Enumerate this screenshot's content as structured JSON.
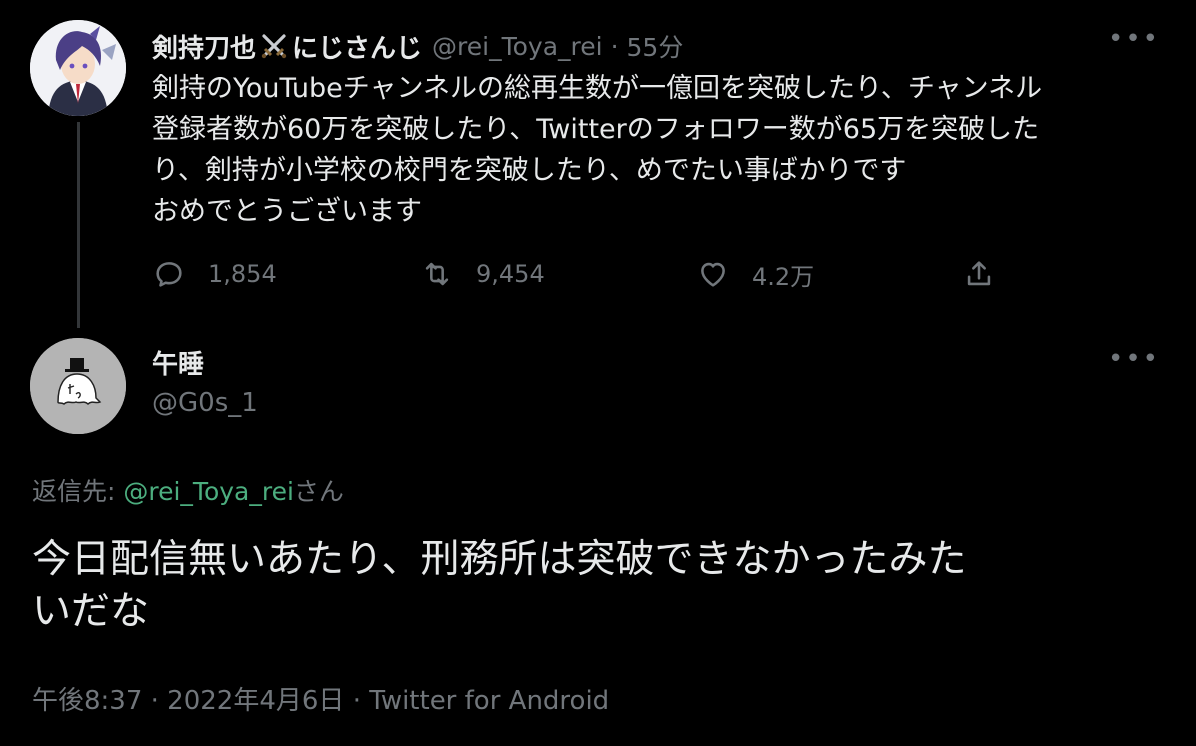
{
  "parent_tweet": {
    "display_name": "剣持刀也",
    "display_name_suffix": "にじさんじ",
    "handle": "@rei_Toya_rei",
    "separator": "·",
    "time": "55分",
    "more_label": "•••",
    "text_lines": [
      "剣持のYouTubeチャンネルの総再生数が一億回を突破したり、チャンネル",
      "登録者数が60万を突破したり、Twitterのフォロワー数が65万を突破した",
      "り、剣持が小学校の校門を突破したり、めでたい事ばかりです",
      "おめでとうございます"
    ],
    "actions": {
      "reply_count": "1,854",
      "retweet_count": "9,454",
      "like_count": "4.2万"
    },
    "icons": [
      "swords-emoji-icon",
      "reply-icon",
      "retweet-icon",
      "like-icon",
      "share-icon"
    ]
  },
  "reply_tweet": {
    "display_name": "午睡",
    "handle": "@G0s_1",
    "more_label": "•••",
    "replying_prefix": "返信先: ",
    "replying_mention": "@rei_Toya_rei",
    "replying_suffix": "さん",
    "text_lines": [
      "今日配信無いあたり、刑務所は突破できなかったみた",
      "いだな"
    ],
    "timestamp": "午後8:37 · 2022年4月6日 · ",
    "client": "Twitter for Android"
  },
  "colors": {
    "background": "#000000",
    "primary_text": "#e7e9ea",
    "secondary_text": "#71767b",
    "mention": "#4cae7f",
    "thread_line": "#333639"
  }
}
